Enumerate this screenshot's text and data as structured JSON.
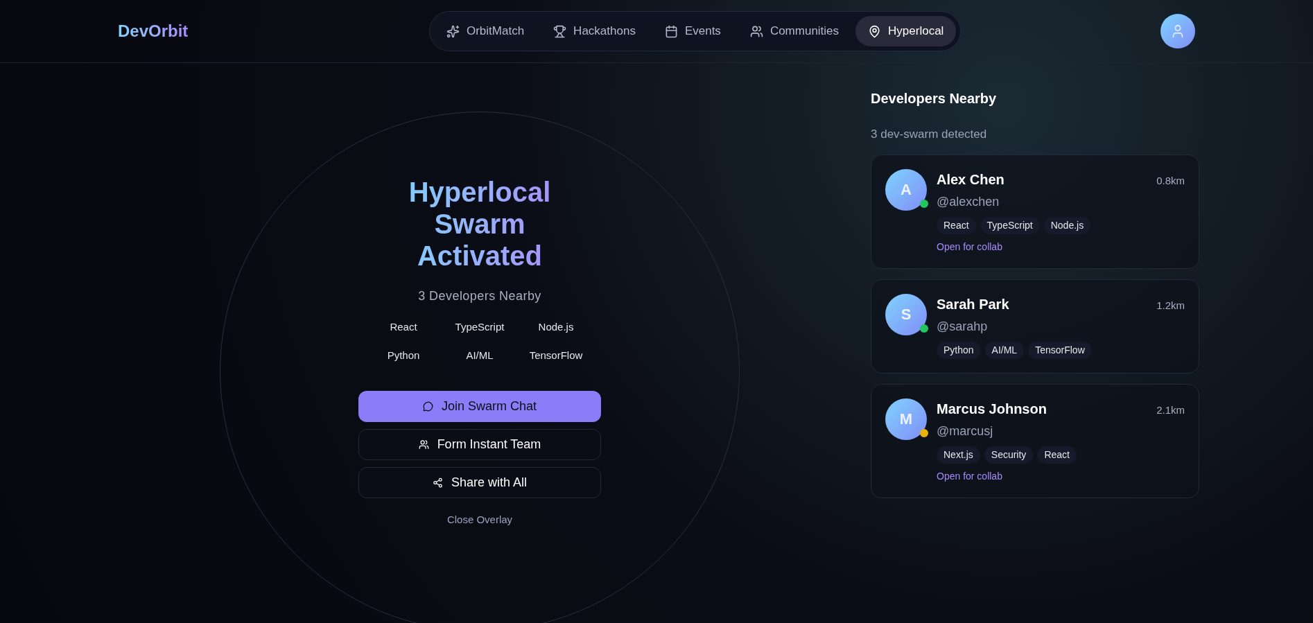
{
  "brand": "DevOrbit",
  "nav": [
    {
      "label": "OrbitMatch",
      "selected": false
    },
    {
      "label": "Hackathons",
      "selected": false
    },
    {
      "label": "Events",
      "selected": false
    },
    {
      "label": "Communities",
      "selected": false
    },
    {
      "label": "Hyperlocal",
      "selected": true
    }
  ],
  "overlay": {
    "title": "Hyperlocal Swarm Activated",
    "subtitle": "3 Developers Nearby",
    "skills": [
      "React",
      "TypeScript",
      "Node.js",
      "Python",
      "AI/ML",
      "TensorFlow"
    ],
    "actions": [
      {
        "label": "Join Swarm Chat",
        "kind": "primary"
      },
      {
        "label": "Form Instant Team",
        "kind": "outline"
      },
      {
        "label": "Share with All",
        "kind": "outline"
      }
    ],
    "close": "Close Overlay"
  },
  "panel": {
    "title": "Developers Nearby",
    "count": "3 dev-swarm detected",
    "developers": [
      {
        "initial": "A",
        "name": "Alex Chen",
        "handle": "@alexchen",
        "distance": "0.8km",
        "color": "#22c55e",
        "tags": [
          "React",
          "TypeScript",
          "Node.js"
        ],
        "status": "Open for collab"
      },
      {
        "initial": "S",
        "name": "Sarah Park",
        "handle": "@sarahp",
        "distance": "1.2km",
        "color": "#22c55e",
        "tags": [
          "Python",
          "AI/ML",
          "TensorFlow"
        ]
      },
      {
        "initial": "M",
        "name": "Marcus Johnson",
        "handle": "@marcusj",
        "distance": "2.1km",
        "color": "#eab308",
        "tags": [
          "Next.js",
          "Security",
          "React"
        ],
        "status": "Open for collab"
      }
    ]
  }
}
